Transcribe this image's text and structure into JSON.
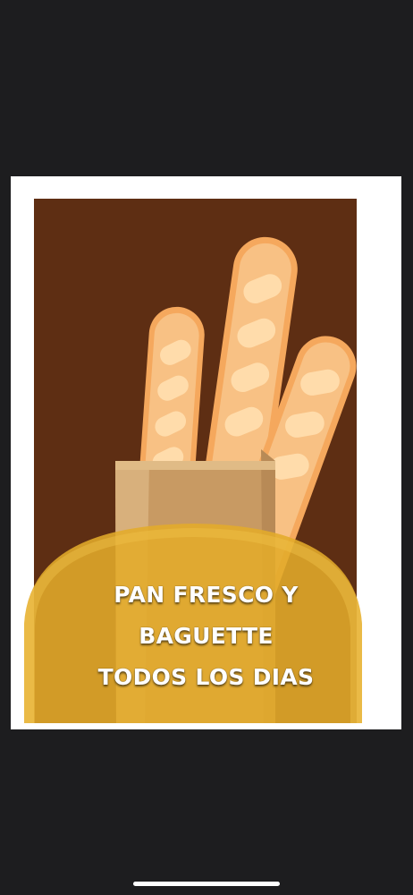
{
  "poster": {
    "headline_lines": [
      "PAN FRESCO Y",
      "BAGUETTE",
      "TODOS LOS DIAS"
    ],
    "colors": {
      "frame": "#ffffff",
      "background": "#5e2e13",
      "banner": "#e2ab2a",
      "bread": "#f7b97a",
      "bag": "#cc9f6a"
    },
    "illustration": [
      "bread-bag-icon",
      "baguette-icon"
    ]
  },
  "system": {
    "home_indicator": "home-indicator"
  }
}
